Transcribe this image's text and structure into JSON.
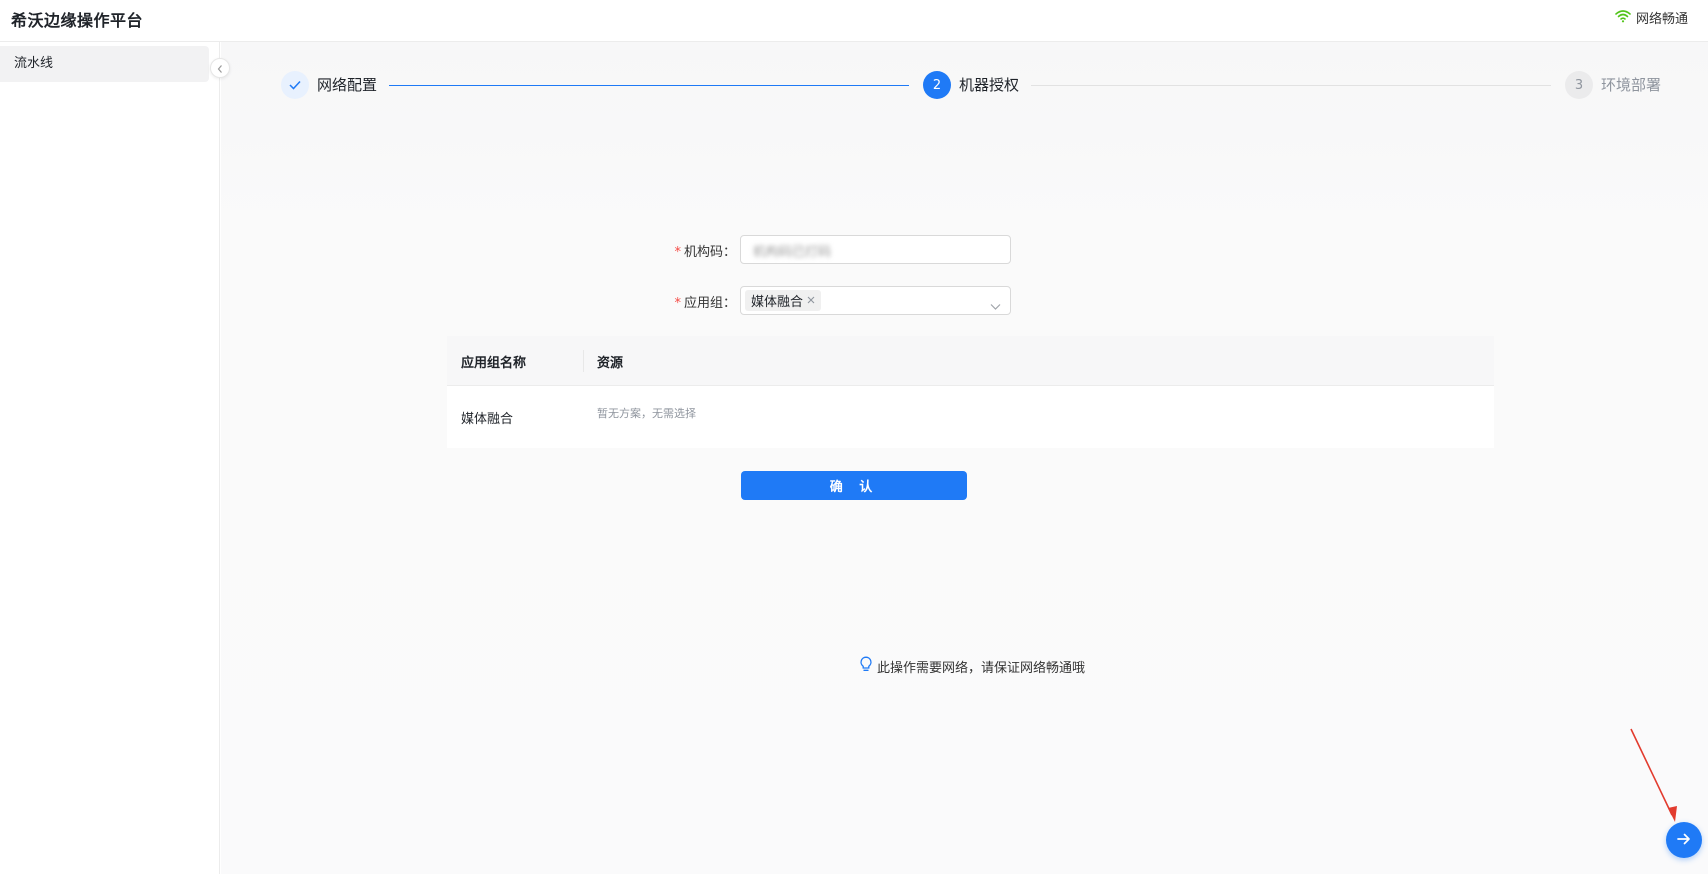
{
  "header": {
    "app_title": "希沃边缘操作平台",
    "network_status": "网络畅通"
  },
  "sidebar": {
    "items": [
      {
        "label": "流水线"
      }
    ]
  },
  "steps": [
    {
      "label": "网络配置",
      "state": "done"
    },
    {
      "number": "2",
      "label": "机器授权",
      "state": "active"
    },
    {
      "number": "3",
      "label": "环境部署",
      "state": "pending"
    }
  ],
  "form": {
    "org_code": {
      "required_mark": "*",
      "label": "机构码：",
      "value": "机构码已打码"
    },
    "app_group": {
      "required_mark": "*",
      "label": "应用组：",
      "selected_tags": [
        "媒体融合"
      ]
    }
  },
  "table": {
    "columns": [
      "应用组名称",
      "资源"
    ],
    "rows": [
      {
        "name": "媒体融合",
        "resource": "暂无方案，无需选择"
      }
    ]
  },
  "confirm_label": "确 认",
  "tip_text": "此操作需要网络，请保证网络畅通哦",
  "colors": {
    "primary": "#1f7af6",
    "success": "#52c41a",
    "required": "#f54a45"
  }
}
